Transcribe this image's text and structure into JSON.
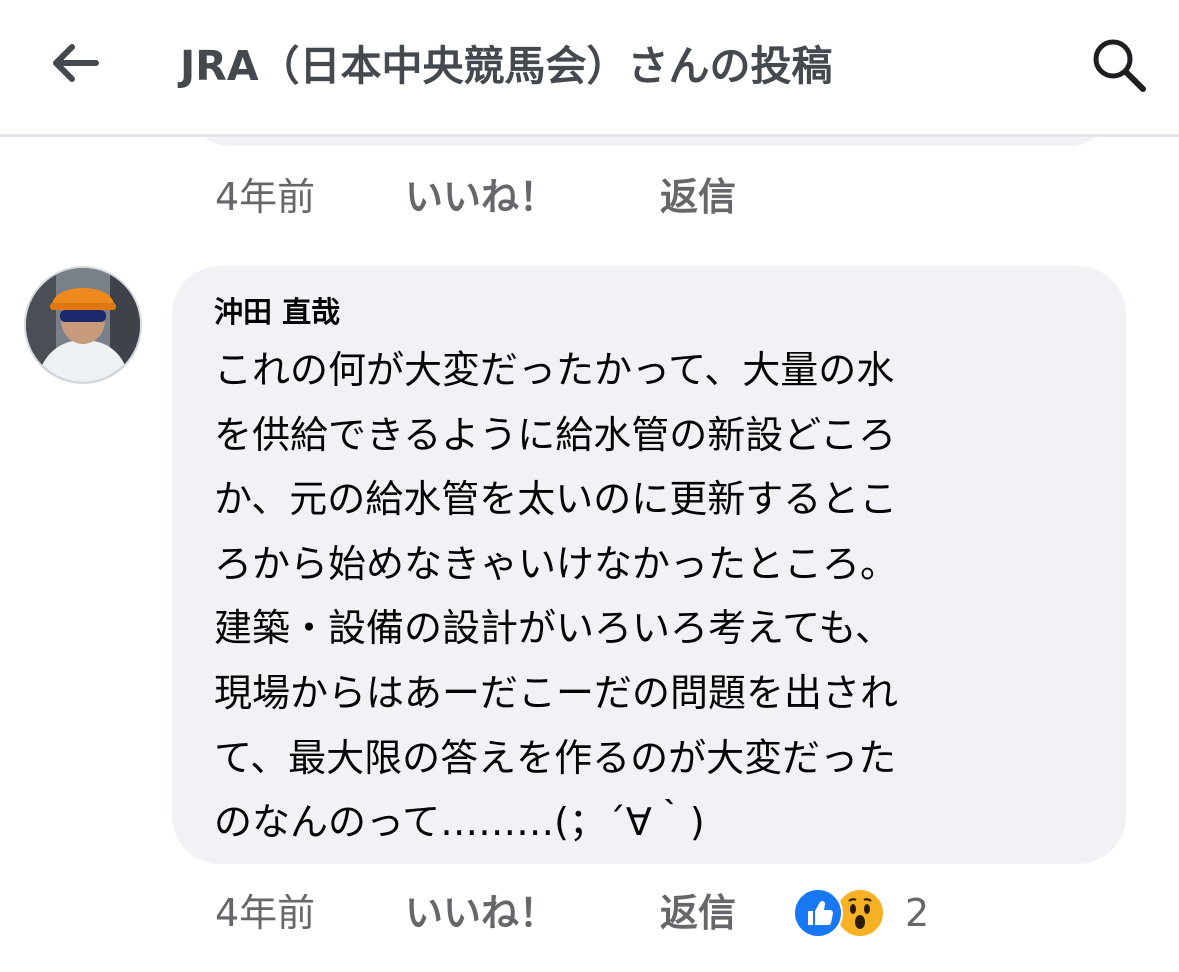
{
  "header": {
    "title": "JRA（日本中央競馬会）さんの投稿",
    "back_icon": "back-arrow-icon",
    "search_icon": "search-icon"
  },
  "previous_comment": {
    "time": "4年前",
    "like_label": "いいね！",
    "reply_label": "返信"
  },
  "comment": {
    "author": "沖田 直哉",
    "text_lines": [
      "これの何が大変だったかって、大量の水",
      "を供給できるように給水管の新設どころ",
      "か、元の給水管を太いのに更新するとこ",
      "ろから始めなきゃいけなかったところ。",
      "建築・設備の設計がいろいろ考えても、",
      "現場からはあーだこーだの問題を出され",
      "て、最大限の答えを作るのが大変だった",
      "のなんのって………(；´∀｀)"
    ],
    "time": "4年前",
    "like_label": "いいね！",
    "reply_label": "返信",
    "reaction_count": "2",
    "reactions": [
      "like-reaction-icon",
      "wow-reaction-icon"
    ]
  },
  "colors": {
    "bubble": "#f0f2f5",
    "meta_text": "#65676b",
    "like_blue": "#1877f2",
    "wow_yellow": "#f7b125"
  }
}
